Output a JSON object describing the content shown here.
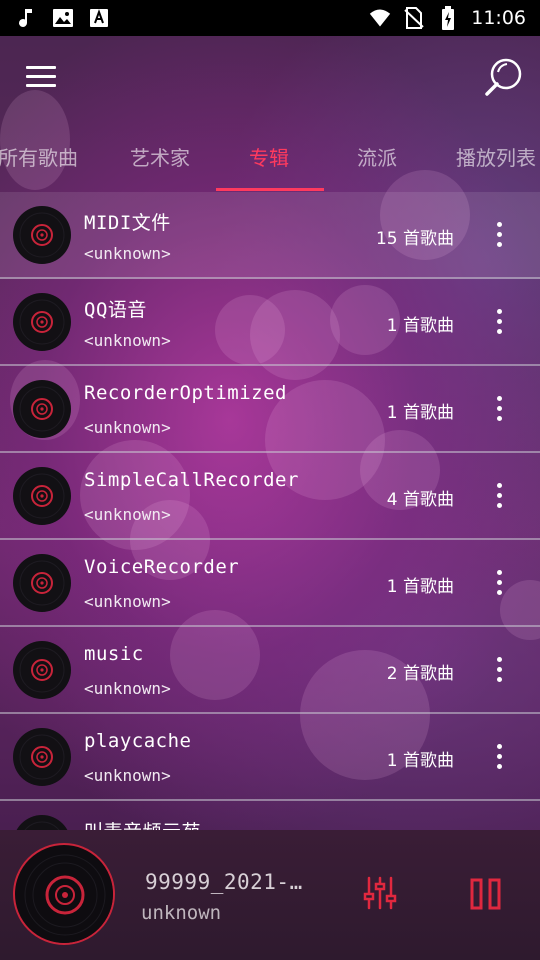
{
  "status_bar": {
    "time": "11:06",
    "left_icons": [
      "music-note-icon",
      "image-icon",
      "font-download-icon"
    ],
    "right_icons": [
      "wifi-icon",
      "no-sim-icon",
      "battery-charging-icon"
    ]
  },
  "app_bar": {
    "menu_icon": "hamburger-menu-icon",
    "search_icon": "search-icon"
  },
  "tabs": [
    {
      "label": "所有歌曲",
      "active": false
    },
    {
      "label": "艺术家",
      "active": false
    },
    {
      "label": "专辑",
      "active": true
    },
    {
      "label": "流派",
      "active": false
    },
    {
      "label": "播放列表",
      "active": false
    }
  ],
  "albums": [
    {
      "title": "MIDI文件",
      "artist": "<unknown>",
      "count": "15 首歌曲"
    },
    {
      "title": "QQ语音",
      "artist": "<unknown>",
      "count": "1 首歌曲"
    },
    {
      "title": "RecorderOptimized",
      "artist": "<unknown>",
      "count": "1 首歌曲"
    },
    {
      "title": "SimpleCallRecorder",
      "artist": "<unknown>",
      "count": "4 首歌曲"
    },
    {
      "title": "VoiceRecorder",
      "artist": "<unknown>",
      "count": "1 首歌曲"
    },
    {
      "title": "music",
      "artist": "<unknown>",
      "count": "2 首歌曲"
    },
    {
      "title": "playcache",
      "artist": "<unknown>",
      "count": "1 首歌曲"
    },
    {
      "title": "叫麦音频元苑",
      "artist": "",
      "count": ""
    }
  ],
  "now_playing": {
    "title": "99999_2021-…",
    "artist": "unknown",
    "equalizer_icon": "equalizer-icon",
    "pause_icon": "pause-icon"
  },
  "colors": {
    "accent": "#ff3a5e",
    "disc_ring": "#c8243a",
    "status_bar": "#000000"
  }
}
